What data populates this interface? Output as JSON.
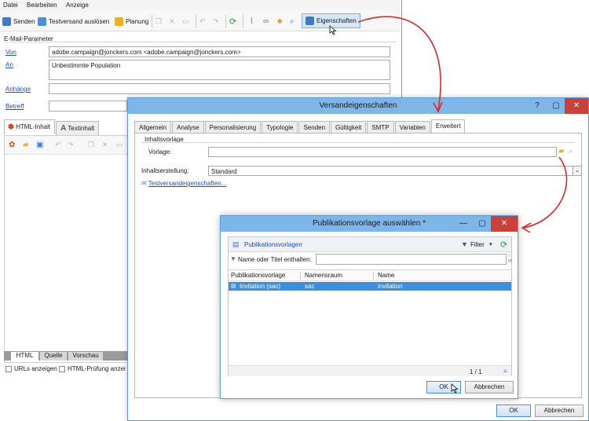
{
  "main_window": {
    "menu": [
      "Datei",
      "Bearbeiten",
      "Anzeige"
    ],
    "toolbar": {
      "send_label": "Senden",
      "test_send_label": "Testversand auslösen",
      "schedule_label": "Planung",
      "properties_label": "Eigenschaften"
    },
    "email_params": {
      "section_label": "E-Mail-Parameter",
      "from_label": "Von",
      "from_value": "adobe.campaign@jonckers.com <adobe.campaign@jonckers.com>",
      "to_label": "An",
      "to_value": "Unbestimmte Population",
      "attachments_label": "Anhänge",
      "subject_label": "Betreff"
    },
    "content_tabs": [
      "HTML-Inhalt",
      "Textinhalt"
    ],
    "bottom_tabs": [
      "HTML",
      "Quelle",
      "Vorschau"
    ],
    "checkboxes": [
      "URLs anzeigen",
      "HTML-Prüfung anzei"
    ]
  },
  "delivery_dialog": {
    "title": "Versandeigenschaften",
    "tabs": [
      "Allgemein",
      "Analyse",
      "Personalisierung",
      "Typologie",
      "Senden",
      "Gültigkeit",
      "SMTP",
      "Variablen",
      "Erweitert"
    ],
    "active_tab": "Erweitert",
    "group_label": "Inhaltsvorlage",
    "template_label": "Vorlage:",
    "template_value": "",
    "creation_label": "Inhaltserstellung:",
    "creation_value": "Standard",
    "test_link": "Testversandeigenschaften...",
    "ok": "OK",
    "cancel": "Abbrechen"
  },
  "template_dialog": {
    "title": "Publikationsvorlage auswählen *",
    "folder_label": "Publikationsvorlagen",
    "filter_label": "Filter",
    "search_label": "Name oder Titel enthalten:",
    "search_value": "",
    "columns": [
      "Publikationsvorlage",
      "Namensraum",
      "Name"
    ],
    "rows": [
      {
        "template": "Invitation (sac)",
        "namespace": "sac",
        "name": "invitation"
      }
    ],
    "pager": "1 / 1",
    "ok": "OK",
    "cancel": "Abbrechen"
  },
  "colors": {
    "title_bar": "#7fb6e8",
    "selection": "#3c8ee0",
    "close": "#c8413a",
    "arrow": "#d9282a"
  }
}
